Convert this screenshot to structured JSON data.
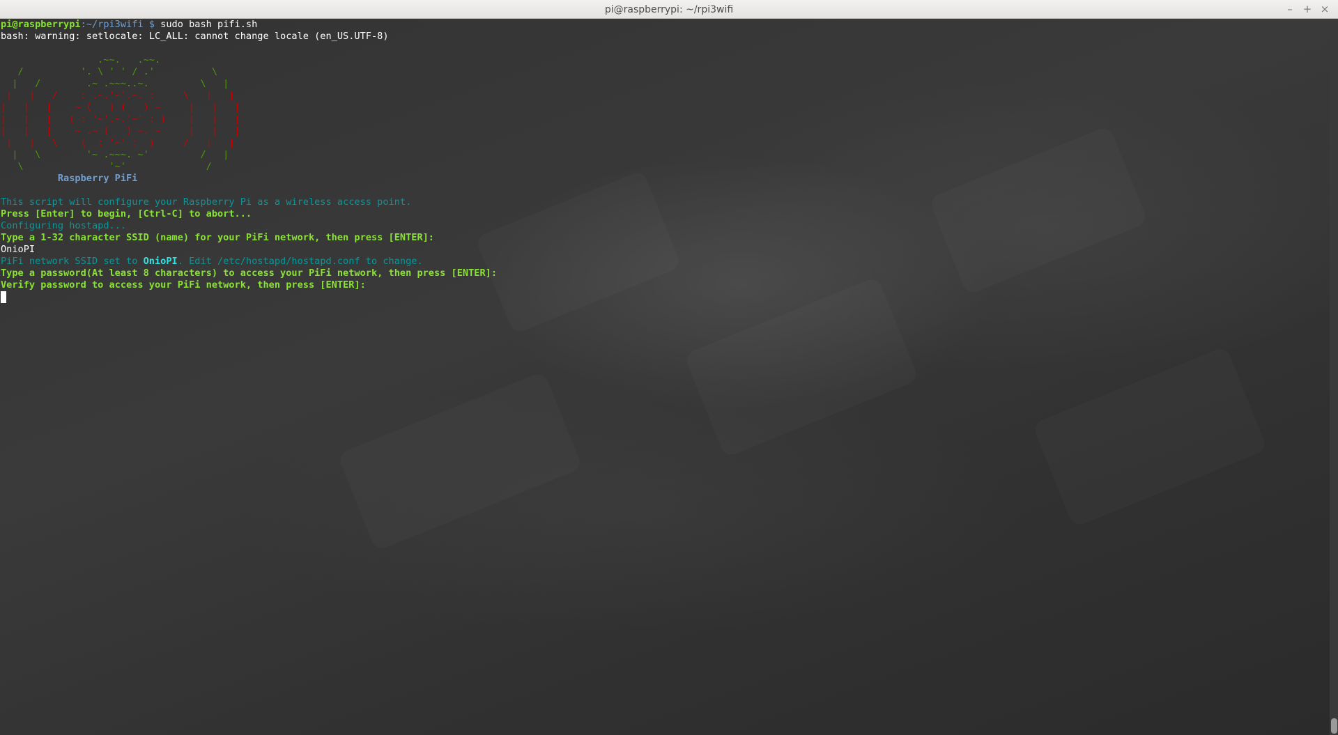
{
  "window": {
    "title": "pi@raspberrypi: ~/rpi3wifi",
    "buttons": {
      "minimize": "–",
      "maximize": "+",
      "close": "×"
    }
  },
  "terminal": {
    "prompt_user": "pi@raspberrypi",
    "prompt_path": ":~/rpi3wifi $",
    "command": " sudo bash pifi.sh",
    "warning": "bash: warning: setlocale: LC_ALL: cannot change locale (en_US.UTF-8)",
    "art_lines": [
      "                 .~~.   .~~.",
      "   /          '. \\ ' ' / .'          \\",
      "  |   /        .~ .~~~..~.         \\   |",
      " |   |   /    : .~.'~'.~. :     \\   |   |",
      "|   |   |    ~ (   ) (   ) ~     |   |   |",
      "|   |   |   ( : '~'.~.'~' : )    |   |   |",
      "|   |   |    ~ .~ (   ) ~. ~     |   |   |",
      " |   |   \\    (  : '~' :  )     /   |   |",
      "  |   \\        '~ .~~~. ~'         /   |",
      "   \\               '~'              /"
    ],
    "art_title": "Raspberry PiFi",
    "intro": "This script will configure your Raspberry Pi as a wireless access point.",
    "press_enter": "Press [Enter] to begin, [Ctrl-C] to abort...",
    "configuring": "Configuring hostapd...",
    "ssid_prompt": "Type a 1-32 character SSID (name) for your PiFi network, then press [ENTER]:",
    "ssid_input": "OnioPI",
    "ssid_set_prefix": "PiFi network SSID set to ",
    "ssid_set_value": "OnioPI",
    "ssid_set_suffix": ". Edit /etc/hostapd/hostapd.conf to change.",
    "password_prompt": "Type a password(At least 8 characters) to access your PiFi network, then press [ENTER]:",
    "verify_prompt": "Verify password to access your PiFi network, then press [ENTER]:"
  },
  "colors": {
    "prompt_green": "#8ae234",
    "path_blue": "#729fcf",
    "info_cyan": "#06989a",
    "art_green": "#4e9a06",
    "art_red": "#cc0000"
  }
}
